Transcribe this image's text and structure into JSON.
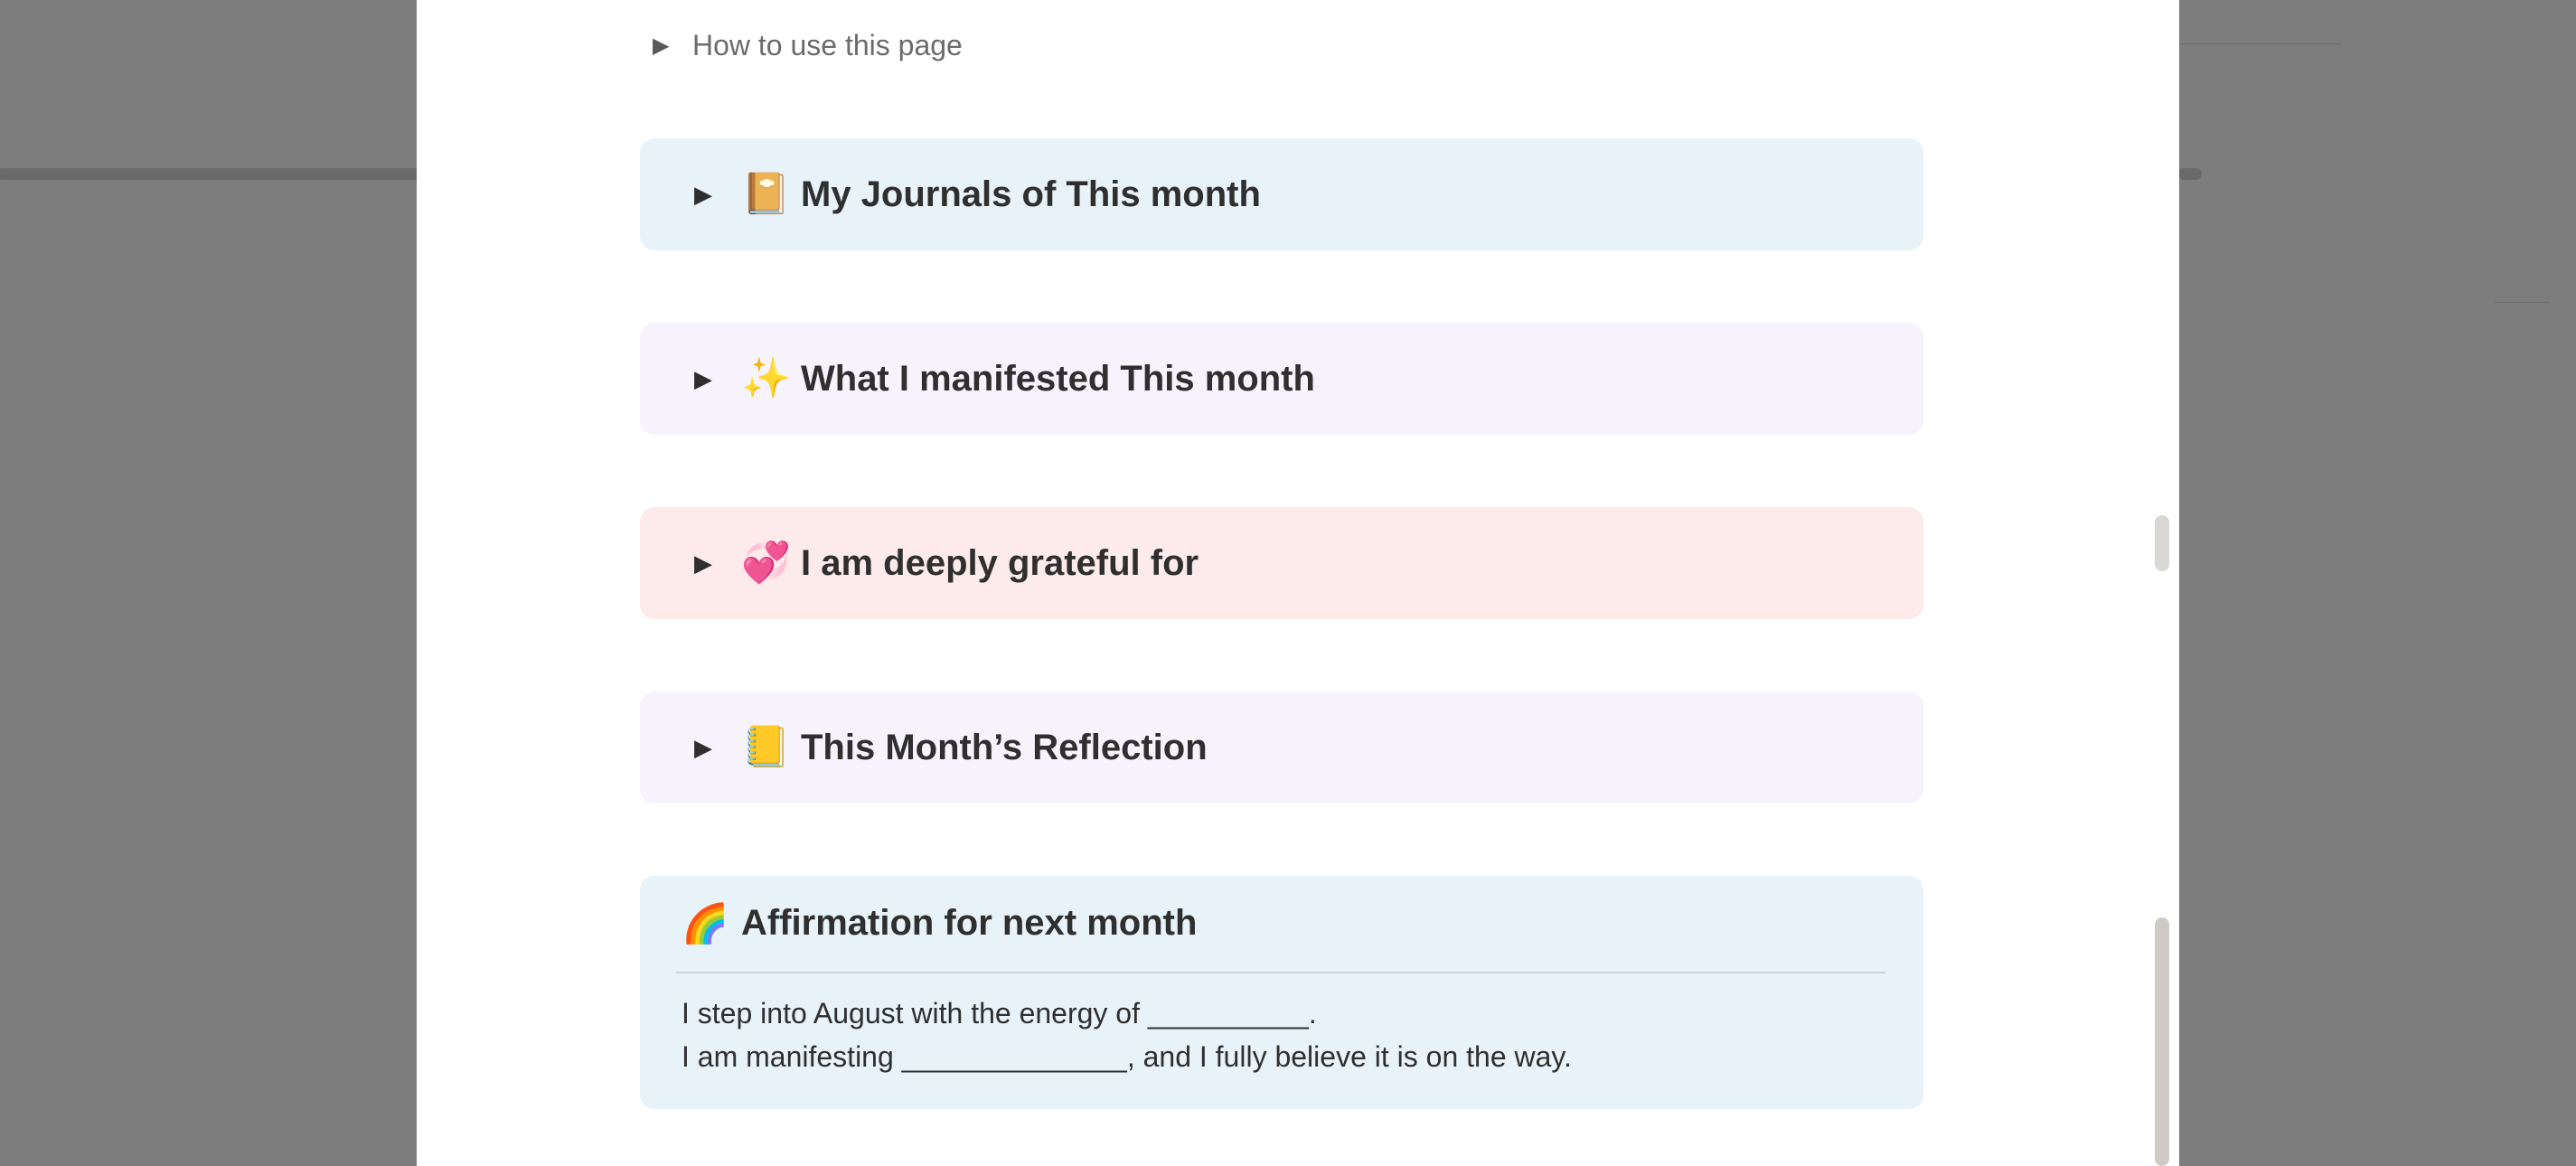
{
  "page": {
    "toggle_howto": "How to use this page",
    "callouts": [
      {
        "icon": "journal-icon",
        "emoji": "📔",
        "title": "My Journals of This month"
      },
      {
        "icon": "sparkles-icon",
        "emoji": "✨",
        "title": "What I manifested This month"
      },
      {
        "icon": "hearts-icon",
        "emoji": "💞",
        "title": "I am deeply grateful for"
      },
      {
        "icon": "sticky-note-icon",
        "emoji": "📒",
        "title": "This Month’s Reflection"
      }
    ],
    "affirmation": {
      "icon": "rainbow-icon",
      "emoji": "🌈",
      "title": "Affirmation for next month",
      "line1": "I step into August with the energy of __________.",
      "line2": "I am manifesting ______________, and I fully believe it is on the way."
    }
  },
  "colors": {
    "backdrop": "#7d7d7d",
    "blue_callout": "#e7f3f8",
    "purple_callout": "#f7f3fd",
    "red_callout": "#fdebec"
  }
}
